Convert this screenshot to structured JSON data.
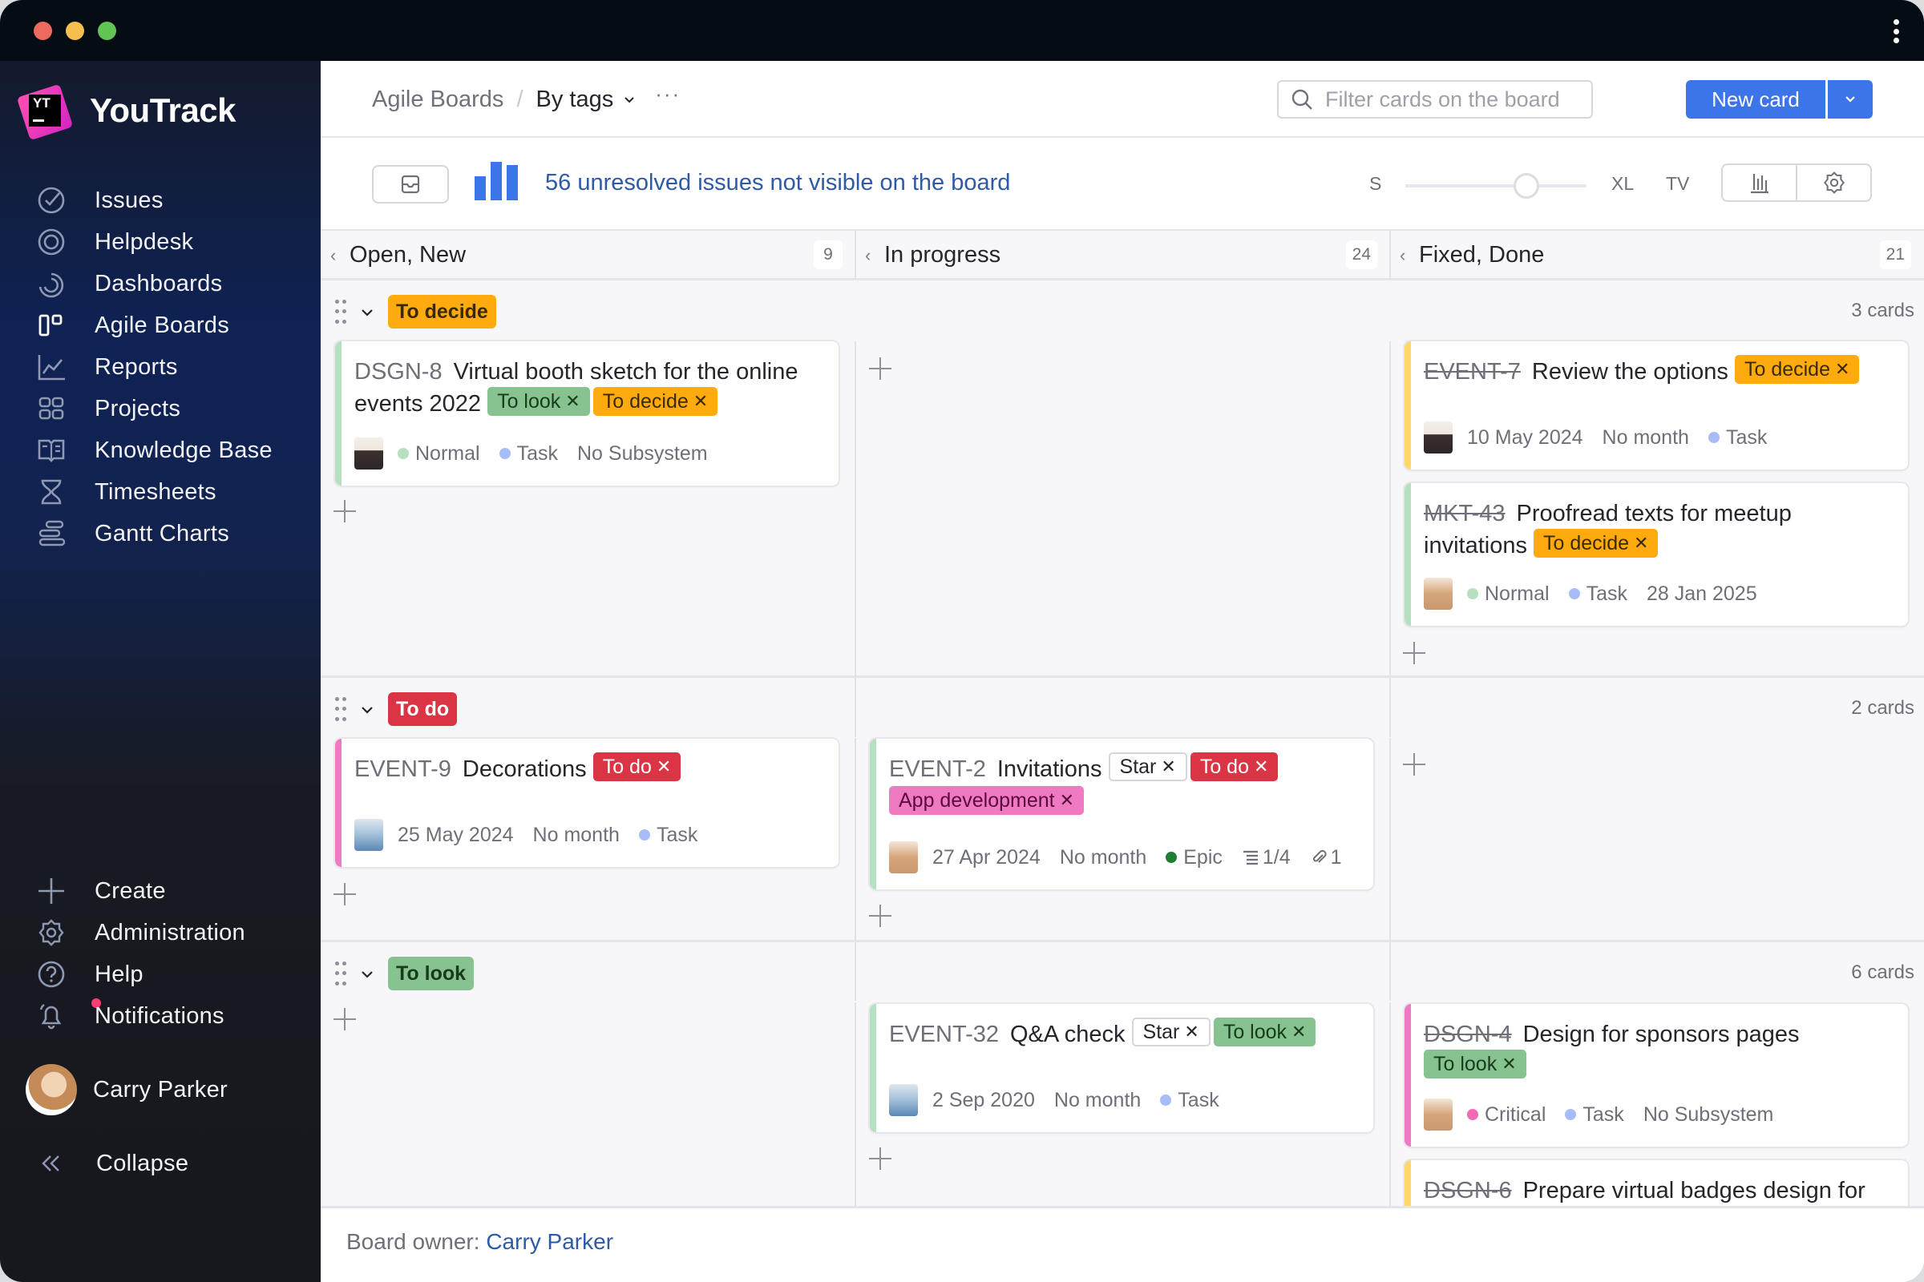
{
  "window": {
    "app_name": "YouTrack",
    "logo_letters": "YT"
  },
  "sidebar": {
    "items": [
      {
        "label": "Issues",
        "icon": "issues-check-icon"
      },
      {
        "label": "Helpdesk",
        "icon": "lifebuoy-icon"
      },
      {
        "label": "Dashboards",
        "icon": "dashboard-icon"
      },
      {
        "label": "Agile Boards",
        "icon": "agile-board-icon",
        "active": true
      },
      {
        "label": "Reports",
        "icon": "reports-chart-icon"
      },
      {
        "label": "Projects",
        "icon": "projects-grid-icon"
      },
      {
        "label": "Knowledge Base",
        "icon": "book-icon"
      },
      {
        "label": "Timesheets",
        "icon": "hourglass-icon"
      },
      {
        "label": "Gantt Charts",
        "icon": "gantt-icon"
      }
    ],
    "bottom_items": [
      {
        "label": "Create",
        "icon": "plus-icon"
      },
      {
        "label": "Administration",
        "icon": "gear-icon"
      },
      {
        "label": "Help",
        "icon": "help-icon"
      },
      {
        "label": "Notifications",
        "icon": "bell-icon",
        "has_badge": true
      }
    ],
    "user": {
      "name": "Carry Parker"
    },
    "collapse_label": "Collapse"
  },
  "header": {
    "breadcrumb_root": "Agile Boards",
    "breadcrumb_separator": "/",
    "board_name": "By tags",
    "more_label": "···",
    "search_placeholder": "Filter cards on the board",
    "search_value": "",
    "new_card_label": "New card"
  },
  "toolbar": {
    "unresolved_text": "56 unresolved issues not visible on the board",
    "size_labels": {
      "small": "S",
      "xl": "XL",
      "tv": "TV"
    },
    "card_size_level": 0.67
  },
  "columns": [
    {
      "name": "Open, New",
      "count": "9"
    },
    {
      "name": "In progress",
      "count": "24"
    },
    {
      "name": "Fixed, Done",
      "count": "21"
    }
  ],
  "swimlanes": [
    {
      "tag": "To decide",
      "count_text": "3 cards",
      "cards": {
        "col0": [
          {
            "id": "DSGN-8",
            "resolved": false,
            "title": "Virtual booth sketch for the online events 2022",
            "tags": [
              {
                "label": "To look",
                "kind": "look"
              },
              {
                "label": "To decide",
                "kind": "decide"
              }
            ],
            "stripe": "#b7e0c0",
            "avatar": "man",
            "fields": [
              {
                "dot": "#b7e0c0",
                "text": "Normal"
              },
              {
                "dot": "#a7bdf7",
                "text": "Task"
              },
              {
                "text": "No Subsystem"
              }
            ]
          }
        ],
        "col2": [
          {
            "id": "EVENT-7",
            "resolved": true,
            "title": "Review the options",
            "tags": [
              {
                "label": "To decide",
                "kind": "decide"
              }
            ],
            "stripe": "#ffd76a",
            "avatar": "man",
            "fields": [
              {
                "text": "10 May 2024"
              },
              {
                "text": "No month"
              },
              {
                "dot": "#a7bdf7",
                "text": "Task"
              }
            ]
          },
          {
            "id": "MKT-43",
            "resolved": true,
            "title": "Proofread texts for meetup invitations",
            "tags": [
              {
                "label": "To decide",
                "kind": "decide"
              }
            ],
            "stripe": "#b7e0c0",
            "avatar": "woman",
            "fields": [
              {
                "dot": "#b7e0c0",
                "text": "Normal"
              },
              {
                "dot": "#a7bdf7",
                "text": "Task"
              },
              {
                "text": "28 Jan 2025"
              }
            ]
          }
        ]
      }
    },
    {
      "tag": "To do",
      "count_text": "2 cards",
      "cards": {
        "col0": [
          {
            "id": "EVENT-9",
            "resolved": false,
            "title": "Decorations",
            "tags": [
              {
                "label": "To do",
                "kind": "todo"
              }
            ],
            "stripe": "#f07ac1",
            "avatar": "office",
            "fields": [
              {
                "text": "25 May 2024"
              },
              {
                "text": "No month"
              },
              {
                "dot": "#a7bdf7",
                "text": "Task"
              }
            ]
          }
        ],
        "col1": [
          {
            "id": "EVENT-2",
            "resolved": false,
            "title": "Invitations",
            "tags": [
              {
                "label": "Star",
                "kind": "star"
              },
              {
                "label": "To do",
                "kind": "todo"
              },
              {
                "label": "App development",
                "kind": "app"
              }
            ],
            "stripe": "#b7e0c0",
            "avatar": "woman",
            "fields": [
              {
                "text": "27 Apr 2024"
              },
              {
                "text": "No month"
              },
              {
                "dot": "#1e7e34",
                "text": "Epic"
              },
              {
                "icon": "subtasks-icon",
                "text": "1/4"
              },
              {
                "icon": "attachment-icon",
                "text": "1"
              }
            ]
          }
        ]
      }
    },
    {
      "tag": "To look",
      "count_text": "6 cards",
      "cards": {
        "col1": [
          {
            "id": "EVENT-32",
            "resolved": false,
            "title": "Q&A check",
            "tags": [
              {
                "label": "Star",
                "kind": "star"
              },
              {
                "label": "To look",
                "kind": "look"
              }
            ],
            "stripe": "#b7e0c0",
            "avatar": "office",
            "fields": [
              {
                "text": "2 Sep 2020"
              },
              {
                "text": "No month"
              },
              {
                "dot": "#a7bdf7",
                "text": "Task"
              }
            ]
          }
        ],
        "col2": [
          {
            "id": "DSGN-4",
            "resolved": true,
            "title": "Design for sponsors pages",
            "tags": [
              {
                "label": "To look",
                "kind": "look"
              }
            ],
            "stripe": "#f07ac1",
            "avatar": "woman",
            "fields": [
              {
                "dot": "#f06bb3",
                "text": "Critical"
              },
              {
                "dot": "#a7bdf7",
                "text": "Task"
              },
              {
                "text": "No Subsystem"
              }
            ]
          },
          {
            "id": "DSGN-6",
            "resolved": true,
            "title": "Prepare virtual badges design for",
            "tags": [],
            "stripe": "#ffd76a",
            "avatar": null,
            "fields": []
          }
        ]
      }
    }
  ],
  "footer": {
    "owner_label": "Board owner:",
    "owner_name": "Carry Parker"
  },
  "colors": {
    "accent": "#3b75e9",
    "link": "#2e5aa7",
    "to_decide": "#ffab0f",
    "to_look": "#87c291",
    "to_do": "#db3545",
    "app_development": "#f07ac1"
  }
}
